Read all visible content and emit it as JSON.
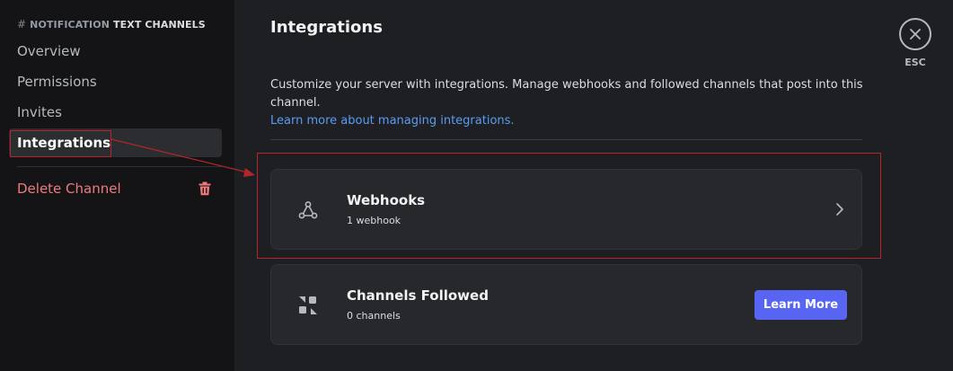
{
  "sidebar": {
    "channel_prefix": "#",
    "channel_name": "NOTIFICATION",
    "category": "TEXT CHANNELS",
    "items": [
      {
        "label": "Overview"
      },
      {
        "label": "Permissions"
      },
      {
        "label": "Invites"
      },
      {
        "label": "Integrations",
        "selected": true
      }
    ],
    "delete_label": "Delete Channel"
  },
  "main": {
    "title": "Integrations",
    "description": "Customize your server with integrations. Manage webhooks and followed channels that post into this channel.",
    "learn_link": "Learn more about managing integrations.",
    "cards": [
      {
        "icon": "webhook-icon",
        "title": "Webhooks",
        "subtitle": "1 webhook",
        "action": "chevron-right-icon"
      },
      {
        "icon": "channels-followed-icon",
        "title": "Channels Followed",
        "subtitle": "0 channels",
        "button_label": "Learn More"
      }
    ]
  },
  "close": {
    "label": "ESC",
    "icon": "close-icon"
  },
  "colors": {
    "accent": "#5865f2",
    "danger": "#f0797a",
    "link": "#5b9cf3",
    "annotation": "#b3262b"
  }
}
